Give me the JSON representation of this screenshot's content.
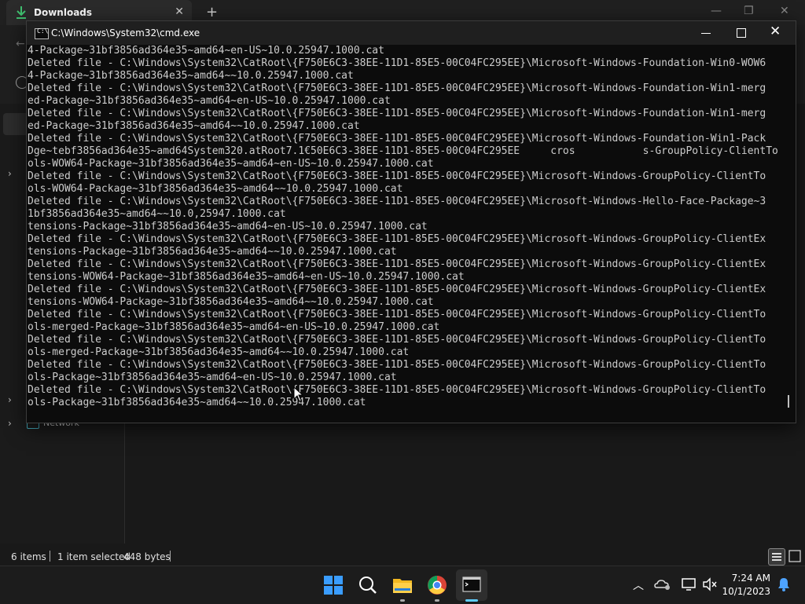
{
  "explorer": {
    "tab_title": "Downloads",
    "tab_close": "✕",
    "new_tab": "+",
    "nav": {
      "network_label": "Network"
    },
    "status": {
      "items": "6 items",
      "selected": "1 item selected",
      "size": "448 bytes"
    }
  },
  "cmd": {
    "title": "C:\\Windows\\System32\\cmd.exe",
    "icon_text": "C:\\",
    "close_glyph": "✕",
    "lines": [
      "4-Package~31bf3856ad364e35~amd64~en-US~10.0.25947.1000.cat",
      "Deleted file - C:\\Windows\\System32\\CatRoot\\{F750E6C3-38EE-11D1-85E5-00C04FC295EE}\\Microsoft-Windows-Foundation-Win0-WOW6",
      "4-Package~31bf3856ad364e35~amd64~~10.0.25947.1000.cat",
      "Deleted file - C:\\Windows\\System32\\CatRoot\\{F750E6C3-38EE-11D1-85E5-00C04FC295EE}\\Microsoft-Windows-Foundation-Win1-merg",
      "ed-Package~31bf3856ad364e35~amd64~en-US~10.0.25947.1000.cat",
      "Deleted file - C:\\Windows\\System32\\CatRoot\\{F750E6C3-38EE-11D1-85E5-00C04FC295EE}\\Microsoft-Windows-Foundation-Win1-merg",
      "ed-Package~31bf3856ad364e35~amd64~~10.0.25947.1000.cat",
      "Deleted file - C:\\Windows\\System32\\CatRoot\\{F750E6C3-38EE-11D1-85E5-00C04FC295EE}\\Microsoft-Windows-Foundation-Win1-Pack",
      "Dge~tebf3856ad364e35~amd64System320.atRoot7.1€50E6C3-38EE-11D1-85E5-00C04FC295EE     cros           s-GroupPolicy-ClientTo",
      "ols-WOW64-Package~31bf3856ad364e35~amd64~en-US~10.0.25947.1000.cat",
      "Deleted file - C:\\Windows\\System32\\CatRoot\\{F750E6C3-38EE-11D1-85E5-00C04FC295EE}\\Microsoft-Windows-GroupPolicy-ClientTo",
      "ols-WOW64-Package~31bf3856ad364e35~amd64~~10.0.25947.1000.cat",
      "Deleted file - C:\\Windows\\System32\\CatRoot\\{F750E6C3-38EE-11D1-85E5-00C04FC295EE}\\Microsoft-Windows-Hello-Face-Package~3",
      "1bf3856ad364e35~amd64~~10.0,25947.1000.cat",
      "tensions-Package~31bf3856ad364e35~amd64~en-US~10.0.25947.1000.cat",
      "Deleted file - C:\\Windows\\System32\\CatRoot\\{F750E6C3-38EE-11D1-85E5-00C04FC295EE}\\Microsoft-Windows-GroupPolicy-ClientEx",
      "tensions-Package~31bf3856ad364e35~amd64~~10.0.25947.1000.cat",
      "Deleted file - C:\\Windows\\System32\\CatRoot\\{F750E6C3-38EE-11D1-85E5-00C04FC295EE}\\Microsoft-Windows-GroupPolicy-ClientEx",
      "tensions-WOW64-Package~31bf3856ad364e35~amd64~en-US~10.0.25947.1000.cat",
      "Deleted file - C:\\Windows\\System32\\CatRoot\\{F750E6C3-38EE-11D1-85E5-00C04FC295EE}\\Microsoft-Windows-GroupPolicy-ClientEx",
      "tensions-WOW64-Package~31bf3856ad364e35~amd64~~10.0.25947.1000.cat",
      "Deleted file - C:\\Windows\\System32\\CatRoot\\{F750E6C3-38EE-11D1-85E5-00C04FC295EE}\\Microsoft-Windows-GroupPolicy-ClientTo",
      "ols-merged-Package~31bf3856ad364e35~amd64~en-US~10.0.25947.1000.cat",
      "Deleted file - C:\\Windows\\System32\\CatRoot\\{F750E6C3-38EE-11D1-85E5-00C04FC295EE}\\Microsoft-Windows-GroupPolicy-ClientTo",
      "ols-merged-Package~31bf3856ad364e35~amd64~~10.0.25947.1000.cat",
      "Deleted file - C:\\Windows\\System32\\CatRoot\\{F750E6C3-38EE-11D1-85E5-00C04FC295EE}\\Microsoft-Windows-GroupPolicy-ClientTo",
      "ols-Package~31bf3856ad364e35~amd64~en-US~10.0.25947.1000.cat",
      "Deleted file - C:\\Windows\\System32\\CatRoot\\{F750E6C3-38EE-11D1-85E5-00C04FC295EE}\\Microsoft-Windows-GroupPolicy-ClientTo",
      "ols-Package~31bf3856ad364e35~amd64~~10.0.25947.1000.cat"
    ]
  },
  "taskbar": {
    "time": "7:24 AM",
    "date": "10/1/2023"
  },
  "colors": {
    "terminal_bg": "#0c0c0c",
    "terminal_text": "#cccccc",
    "accent": "#0078d4",
    "folder": "#f2b821"
  }
}
